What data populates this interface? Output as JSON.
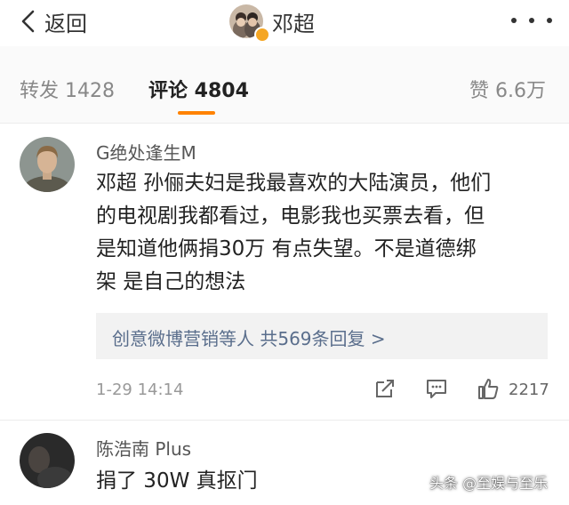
{
  "header": {
    "back_label": "返回",
    "title": "邓超"
  },
  "tabs": [
    {
      "label": "转发 1428"
    },
    {
      "label": "评论 4804"
    },
    {
      "label": "赞 6.6万"
    }
  ],
  "colors": {
    "accent": "#ff8200",
    "verified_badge": "#f5a623",
    "link_text": "#5a6e8c"
  },
  "comments": [
    {
      "username": "G绝处逢生M",
      "text": "邓超 孙俪夫妇是我最喜欢的大陆演员，他们\n的电视剧我都看过，电影我也买票去看，但\n是知道他俩捐30万 有点失望。不是道德绑\n架 是自己的想法",
      "replies_summary": "创意微博营销等人 共569条回复 >",
      "time": "1-29 14:14",
      "likes": "2217",
      "icons": [
        "share-icon",
        "reply-icon",
        "thumbs-up-icon"
      ]
    },
    {
      "username": "陈浩南 Plus",
      "text": "捐了 30W 真抠门"
    }
  ],
  "watermark": "头条 @至娱与至乐"
}
